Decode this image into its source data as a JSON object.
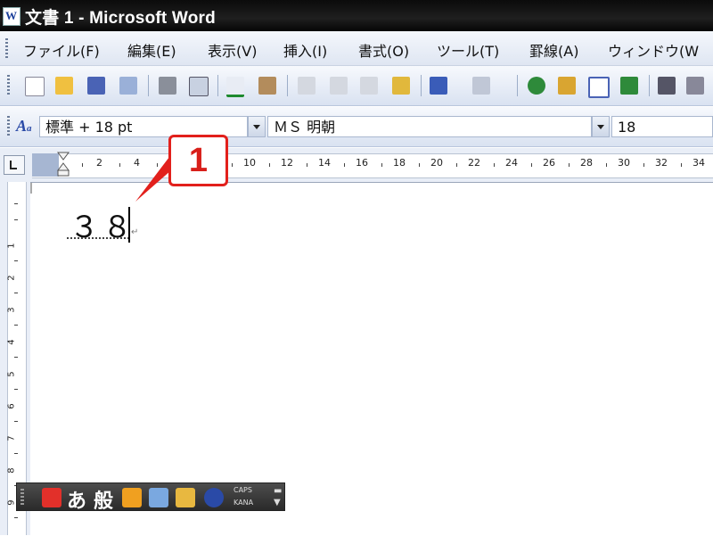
{
  "window": {
    "title": "文書 1 - Microsoft Word"
  },
  "menu": [
    "ファイル(F)",
    "編集(E)",
    "表示(V)",
    "挿入(I)",
    "書式(O)",
    "ツール(T)",
    "罫線(A)",
    "ウィンドウ(W"
  ],
  "format_toolbar": {
    "style": "標準 + 18 pt",
    "font": "ＭＳ 明朝",
    "size": "18"
  },
  "ruler": {
    "labels": [
      "2",
      "4",
      "10",
      "12",
      "14",
      "16",
      "18",
      "20",
      "22",
      "24",
      "26",
      "28",
      "30",
      "32",
      "34"
    ],
    "vlabels": [
      "1",
      "2",
      "3",
      "4",
      "5",
      "6",
      "7",
      "8",
      "9"
    ]
  },
  "document": {
    "text": "３８",
    "paragraph_mark": "↵"
  },
  "callout": {
    "number": "1"
  },
  "ime_bar": {
    "hiragana": "あ",
    "mode": "般",
    "caps": "CAPS",
    "kana": "KANA"
  },
  "colors": {
    "callout": "#e2201c",
    "titlebar": "#0b0b0b",
    "toolbar": "#dfe6f2"
  }
}
